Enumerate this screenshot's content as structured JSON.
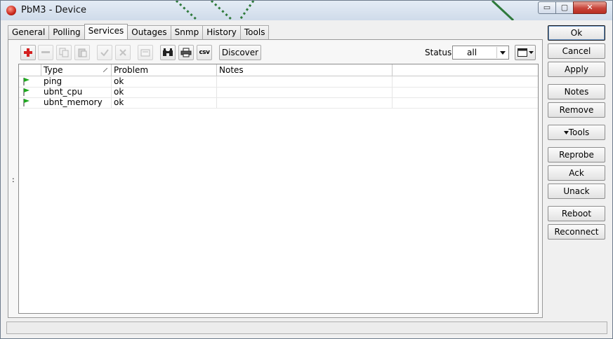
{
  "window": {
    "title": "PbM3 - Device",
    "controls": {
      "min": "▭",
      "max": "▢",
      "close": "✕"
    }
  },
  "tabs": [
    "General",
    "Polling",
    "Services",
    "Outages",
    "Snmp",
    "History",
    "Tools"
  ],
  "active_tab": "Services",
  "toolbar": {
    "discover_label": "Discover",
    "csv_label": "csv",
    "status_label": "Status:",
    "status_value": "all"
  },
  "table": {
    "columns": [
      "Type",
      "Problem",
      "Notes"
    ],
    "rows": [
      {
        "type": "ping",
        "problem": "ok",
        "notes": ""
      },
      {
        "type": "ubnt_cpu",
        "problem": "ok",
        "notes": ""
      },
      {
        "type": "ubnt_memory",
        "problem": "ok",
        "notes": ""
      }
    ]
  },
  "side_marker": ":",
  "buttons": {
    "ok": "Ok",
    "cancel": "Cancel",
    "apply": "Apply",
    "notes": "Notes",
    "remove": "Remove",
    "tools": "Tools",
    "reprobe": "Reprobe",
    "ack": "Ack",
    "unack": "Unack",
    "reboot": "Reboot",
    "reconnect": "Reconnect"
  },
  "colors": {
    "add_red": "#d42020",
    "flag_green": "#1ea81e",
    "titlebar": "#dbe5f1",
    "close_red": "#c7443a"
  }
}
